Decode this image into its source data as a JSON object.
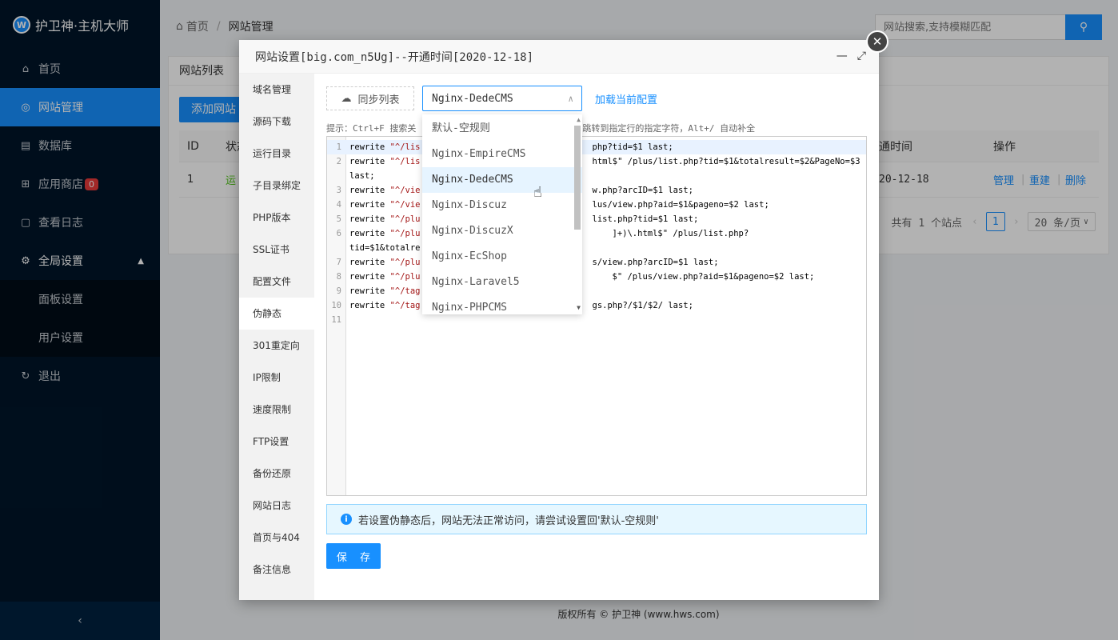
{
  "app": {
    "logo_letter": "W",
    "title": "护卫神·主机大师"
  },
  "sidebar": {
    "items": [
      {
        "label": "首页",
        "icon": "home-icon"
      },
      {
        "label": "网站管理",
        "icon": "globe-icon"
      },
      {
        "label": "数据库",
        "icon": "database-icon"
      },
      {
        "label": "应用商店",
        "icon": "apps-icon",
        "badge": "0"
      },
      {
        "label": "查看日志",
        "icon": "log-icon"
      },
      {
        "label": "全局设置",
        "icon": "gear-icon"
      }
    ],
    "submenu": [
      {
        "label": "面板设置"
      },
      {
        "label": "用户设置"
      }
    ],
    "logout": "退出",
    "collapse": "‹"
  },
  "breadcrumb": {
    "home": "首页",
    "separator": "/",
    "current": "网站管理"
  },
  "search": {
    "placeholder": "网站搜索,支持模糊匹配"
  },
  "site_list": {
    "title": "网站列表",
    "add_button": "添加网站",
    "columns": {
      "id": "ID",
      "status": "状态",
      "time": "通时间",
      "actions": "操作"
    },
    "rows": [
      {
        "id": "1",
        "status": "运",
        "time": "20-12-18",
        "manage": "管理",
        "rebuild": "重建",
        "delete": "删除"
      }
    ],
    "pagination": {
      "total": "共有 1 个站点",
      "page": "1",
      "page_size": "20 条/页"
    }
  },
  "footer": "版权所有 © 护卫神 (www.hws.com)",
  "modal": {
    "title": "网站设置[big.com_n5Ug]--开通时间[2020-12-18]",
    "tabs": [
      "域名管理",
      "源码下载",
      "运行目录",
      "子目录绑定",
      "PHP版本",
      "SSL证书",
      "配置文件",
      "伪静态",
      "301重定向",
      "IP限制",
      "速度限制",
      "FTP设置",
      "备份还原",
      "网站日志",
      "首页与404",
      "备注信息"
    ],
    "active_tab": "伪静态",
    "sync_button": "同步列表",
    "select_value": "Nginx-DedeCMS",
    "load_link": "加载当前配置",
    "hint": "提示：Ctrl+F 搜索关",
    "hint_tail": "跳转到指定行的指定字符，Alt+/ 自动补全",
    "code_lines": [
      {
        "n": "1",
        "pre": "rewrite ",
        "s1": "\"^/lis",
        "mid": "",
        "s2": "",
        "tail": "php?tid=$1 last;"
      },
      {
        "n": "2",
        "pre": "rewrite ",
        "s1": "\"^/lis",
        "mid": "",
        "s2": "",
        "tail": "html$\" /plus/list.php?tid=$1&totalresult=$2&PageNo=$3"
      },
      {
        "n": "",
        "pre": "last;",
        "s1": "",
        "mid": "",
        "s2": "",
        "tail": ""
      },
      {
        "n": "3",
        "pre": "rewrite ",
        "s1": "\"^/vie",
        "mid": "",
        "s2": "",
        "tail": "w.php?arcID=$1 last;"
      },
      {
        "n": "4",
        "pre": "rewrite ",
        "s1": "\"^/vie",
        "mid": "",
        "s2": "",
        "tail": "lus/view.php?aid=$1&pageno=$2 last;"
      },
      {
        "n": "5",
        "pre": "rewrite ",
        "s1": "\"^/plu",
        "mid": "",
        "s2": "",
        "tail": "list.php?tid=$1 last;"
      },
      {
        "n": "6",
        "pre": "rewrite ",
        "s1": "\"^/plu",
        "mid": "",
        "s2": "",
        "tail": "]+)\\.html$\" /plus/list.php?"
      },
      {
        "n": "",
        "pre": "tid=$1&totalre",
        "s1": "",
        "mid": "",
        "s2": "",
        "tail": ""
      },
      {
        "n": "7",
        "pre": "rewrite ",
        "s1": "\"^/plu",
        "mid": "",
        "s2": "",
        "tail": "s/view.php?arcID=$1 last;"
      },
      {
        "n": "8",
        "pre": "rewrite ",
        "s1": "\"^/plu",
        "mid": "",
        "s2": "",
        "tail": "$\" /plus/view.php?aid=$1&pageno=$2 last;"
      },
      {
        "n": "9",
        "pre": "rewrite ",
        "s1": "\"^/tag",
        "mid": "",
        "s2": "",
        "tail": ""
      },
      {
        "n": "10",
        "pre": "rewrite ",
        "s1": "\"^/tag",
        "mid": "",
        "s2": "",
        "tail": "gs.php?/$1/$2/ last;"
      },
      {
        "n": "11",
        "pre": "",
        "s1": "",
        "mid": "",
        "s2": "",
        "tail": ""
      }
    ],
    "dropdown_options": [
      "默认-空规则",
      "Nginx-EmpireCMS",
      "Nginx-DedeCMS",
      "Nginx-Discuz",
      "Nginx-DiscuzX",
      "Nginx-EcShop",
      "Nginx-Laravel5",
      "Nginx-PHPCMS"
    ],
    "dropdown_selected": "Nginx-DedeCMS",
    "alert": "若设置伪静态后，网站无法正常访问，请尝试设置回'默认-空规则'",
    "save_button": "保 存"
  }
}
